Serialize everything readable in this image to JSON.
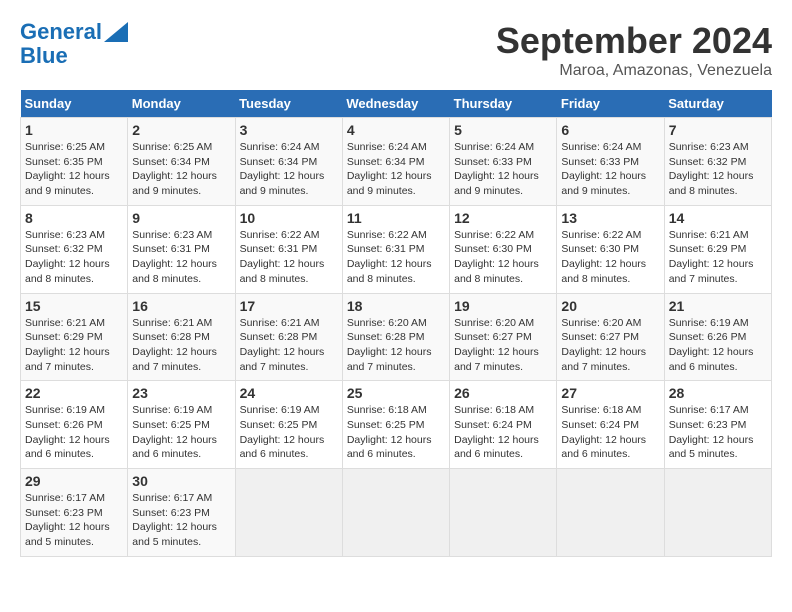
{
  "logo": {
    "line1": "General",
    "line2": "Blue"
  },
  "title": "September 2024",
  "subtitle": "Maroa, Amazonas, Venezuela",
  "days_of_week": [
    "Sunday",
    "Monday",
    "Tuesday",
    "Wednesday",
    "Thursday",
    "Friday",
    "Saturday"
  ],
  "weeks": [
    [
      {
        "day": 1,
        "info": "Sunrise: 6:25 AM\nSunset: 6:35 PM\nDaylight: 12 hours\nand 9 minutes."
      },
      {
        "day": 2,
        "info": "Sunrise: 6:25 AM\nSunset: 6:34 PM\nDaylight: 12 hours\nand 9 minutes."
      },
      {
        "day": 3,
        "info": "Sunrise: 6:24 AM\nSunset: 6:34 PM\nDaylight: 12 hours\nand 9 minutes."
      },
      {
        "day": 4,
        "info": "Sunrise: 6:24 AM\nSunset: 6:34 PM\nDaylight: 12 hours\nand 9 minutes."
      },
      {
        "day": 5,
        "info": "Sunrise: 6:24 AM\nSunset: 6:33 PM\nDaylight: 12 hours\nand 9 minutes."
      },
      {
        "day": 6,
        "info": "Sunrise: 6:24 AM\nSunset: 6:33 PM\nDaylight: 12 hours\nand 9 minutes."
      },
      {
        "day": 7,
        "info": "Sunrise: 6:23 AM\nSunset: 6:32 PM\nDaylight: 12 hours\nand 8 minutes."
      }
    ],
    [
      {
        "day": 8,
        "info": "Sunrise: 6:23 AM\nSunset: 6:32 PM\nDaylight: 12 hours\nand 8 minutes."
      },
      {
        "day": 9,
        "info": "Sunrise: 6:23 AM\nSunset: 6:31 PM\nDaylight: 12 hours\nand 8 minutes."
      },
      {
        "day": 10,
        "info": "Sunrise: 6:22 AM\nSunset: 6:31 PM\nDaylight: 12 hours\nand 8 minutes."
      },
      {
        "day": 11,
        "info": "Sunrise: 6:22 AM\nSunset: 6:31 PM\nDaylight: 12 hours\nand 8 minutes."
      },
      {
        "day": 12,
        "info": "Sunrise: 6:22 AM\nSunset: 6:30 PM\nDaylight: 12 hours\nand 8 minutes."
      },
      {
        "day": 13,
        "info": "Sunrise: 6:22 AM\nSunset: 6:30 PM\nDaylight: 12 hours\nand 8 minutes."
      },
      {
        "day": 14,
        "info": "Sunrise: 6:21 AM\nSunset: 6:29 PM\nDaylight: 12 hours\nand 7 minutes."
      }
    ],
    [
      {
        "day": 15,
        "info": "Sunrise: 6:21 AM\nSunset: 6:29 PM\nDaylight: 12 hours\nand 7 minutes."
      },
      {
        "day": 16,
        "info": "Sunrise: 6:21 AM\nSunset: 6:28 PM\nDaylight: 12 hours\nand 7 minutes."
      },
      {
        "day": 17,
        "info": "Sunrise: 6:21 AM\nSunset: 6:28 PM\nDaylight: 12 hours\nand 7 minutes."
      },
      {
        "day": 18,
        "info": "Sunrise: 6:20 AM\nSunset: 6:28 PM\nDaylight: 12 hours\nand 7 minutes."
      },
      {
        "day": 19,
        "info": "Sunrise: 6:20 AM\nSunset: 6:27 PM\nDaylight: 12 hours\nand 7 minutes."
      },
      {
        "day": 20,
        "info": "Sunrise: 6:20 AM\nSunset: 6:27 PM\nDaylight: 12 hours\nand 7 minutes."
      },
      {
        "day": 21,
        "info": "Sunrise: 6:19 AM\nSunset: 6:26 PM\nDaylight: 12 hours\nand 6 minutes."
      }
    ],
    [
      {
        "day": 22,
        "info": "Sunrise: 6:19 AM\nSunset: 6:26 PM\nDaylight: 12 hours\nand 6 minutes."
      },
      {
        "day": 23,
        "info": "Sunrise: 6:19 AM\nSunset: 6:25 PM\nDaylight: 12 hours\nand 6 minutes."
      },
      {
        "day": 24,
        "info": "Sunrise: 6:19 AM\nSunset: 6:25 PM\nDaylight: 12 hours\nand 6 minutes."
      },
      {
        "day": 25,
        "info": "Sunrise: 6:18 AM\nSunset: 6:25 PM\nDaylight: 12 hours\nand 6 minutes."
      },
      {
        "day": 26,
        "info": "Sunrise: 6:18 AM\nSunset: 6:24 PM\nDaylight: 12 hours\nand 6 minutes."
      },
      {
        "day": 27,
        "info": "Sunrise: 6:18 AM\nSunset: 6:24 PM\nDaylight: 12 hours\nand 6 minutes."
      },
      {
        "day": 28,
        "info": "Sunrise: 6:17 AM\nSunset: 6:23 PM\nDaylight: 12 hours\nand 5 minutes."
      }
    ],
    [
      {
        "day": 29,
        "info": "Sunrise: 6:17 AM\nSunset: 6:23 PM\nDaylight: 12 hours\nand 5 minutes."
      },
      {
        "day": 30,
        "info": "Sunrise: 6:17 AM\nSunset: 6:23 PM\nDaylight: 12 hours\nand 5 minutes."
      },
      null,
      null,
      null,
      null,
      null
    ]
  ]
}
